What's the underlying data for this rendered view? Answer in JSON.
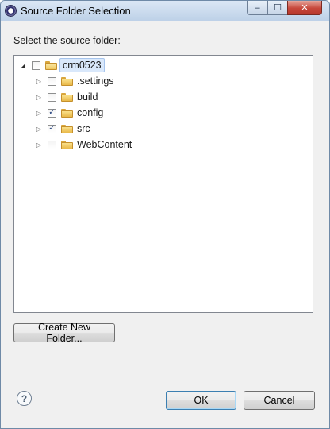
{
  "window": {
    "title": "Source Folder Selection",
    "app_icon": "eclipse-icon",
    "controls": {
      "minimize": "‒",
      "maximize": "☐",
      "close": "✕"
    }
  },
  "dialog": {
    "prompt": "Select the source folder:",
    "tree": {
      "root": {
        "label": "crm0523",
        "expanded": true,
        "checked": false,
        "selected": true,
        "icon": "project-folder-icon"
      },
      "children": [
        {
          "label": ".settings",
          "checked": false,
          "icon": "folder-icon"
        },
        {
          "label": "build",
          "checked": false,
          "icon": "folder-icon"
        },
        {
          "label": "config",
          "checked": true,
          "icon": "folder-icon"
        },
        {
          "label": "src",
          "checked": true,
          "icon": "folder-icon"
        },
        {
          "label": "WebContent",
          "checked": false,
          "icon": "folder-icon"
        }
      ]
    },
    "create_folder_label": "Create New Folder...",
    "ok_label": "OK",
    "cancel_label": "Cancel",
    "help_icon": "help-icon",
    "help_glyph": "?"
  }
}
